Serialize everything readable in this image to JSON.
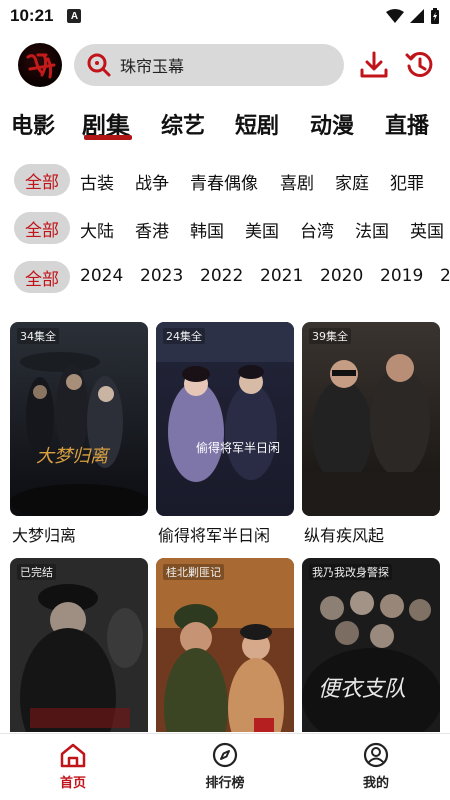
{
  "status_bar": {
    "time": "10:21",
    "notif_letter": "A"
  },
  "header": {
    "search_text": "珠帘玉幕",
    "icons": [
      "logo-avatar",
      "search-icon",
      "download-icon",
      "history-icon"
    ]
  },
  "category_tabs": [
    "电影",
    "剧集",
    "综艺",
    "短剧",
    "动漫",
    "直播"
  ],
  "active_category": "剧集",
  "filters": {
    "genre": {
      "selected": "全部",
      "options": [
        "古装",
        "战争",
        "青春偶像",
        "喜剧",
        "家庭",
        "犯罪"
      ]
    },
    "region": {
      "selected": "全部",
      "options": [
        "大陆",
        "香港",
        "韩国",
        "美国",
        "台湾",
        "法国",
        "英国"
      ]
    },
    "year": {
      "selected": "全部",
      "options": [
        "2024",
        "2023",
        "2022",
        "2021",
        "2020",
        "2019",
        "2"
      ]
    }
  },
  "shows": [
    {
      "title": "大梦归离",
      "badge": "34集全",
      "poster_text": "大梦归离"
    },
    {
      "title": "偷得将军半日闲",
      "badge": "24集全",
      "poster_text": "偷得将军半日闲"
    },
    {
      "title": "纵有疾风起",
      "badge": "39集全",
      "poster_text": ""
    },
    {
      "title": "",
      "badge": "已完结",
      "poster_text": ""
    },
    {
      "title": "",
      "badge": "桂北剿匪记",
      "poster_text": ""
    },
    {
      "title": "",
      "badge": "我乃我改身警探",
      "poster_text": "便衣支队"
    }
  ],
  "bottom_nav": [
    {
      "label": "首页",
      "icon": "home-icon",
      "active": true
    },
    {
      "label": "排行榜",
      "icon": "compass-icon",
      "active": false
    },
    {
      "label": "我的",
      "icon": "profile-icon",
      "active": false
    }
  ],
  "colors": {
    "accent": "#c0141a",
    "chip_bg": "#d5d5d5",
    "search_bg": "#d9d9d9"
  }
}
